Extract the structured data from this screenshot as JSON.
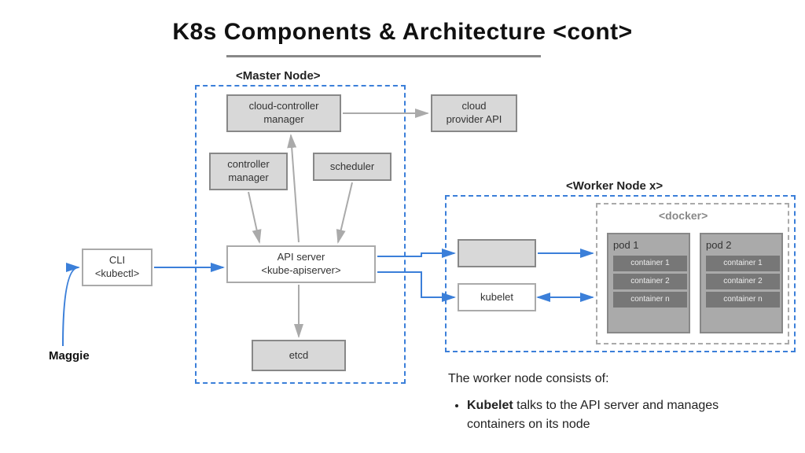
{
  "title": "K8s Components & Architecture <cont>",
  "master_label": "<Master Node>",
  "worker_label": "<Worker Node x>",
  "docker_label": "<docker>",
  "user": "Maggie",
  "cli": "CLI\n<kubectl>",
  "ccm": "cloud-controller\nmanager",
  "cloud_api": "cloud\nprovider API",
  "cm": "controller\nmanager",
  "scheduler": "scheduler",
  "api_server": "API server\n<kube-apiserver>",
  "etcd": "etcd",
  "kube_proxy": "",
  "kubelet": "kubelet",
  "pod1": "pod 1",
  "pod2": "pod 2",
  "containers": [
    "container 1",
    "container 2",
    "container n"
  ],
  "desc_intro": "The worker node consists of:",
  "bullet_kubelet_strong": "Kubelet",
  "bullet_kubelet_rest": " talks to the API server and manages containers on its node"
}
